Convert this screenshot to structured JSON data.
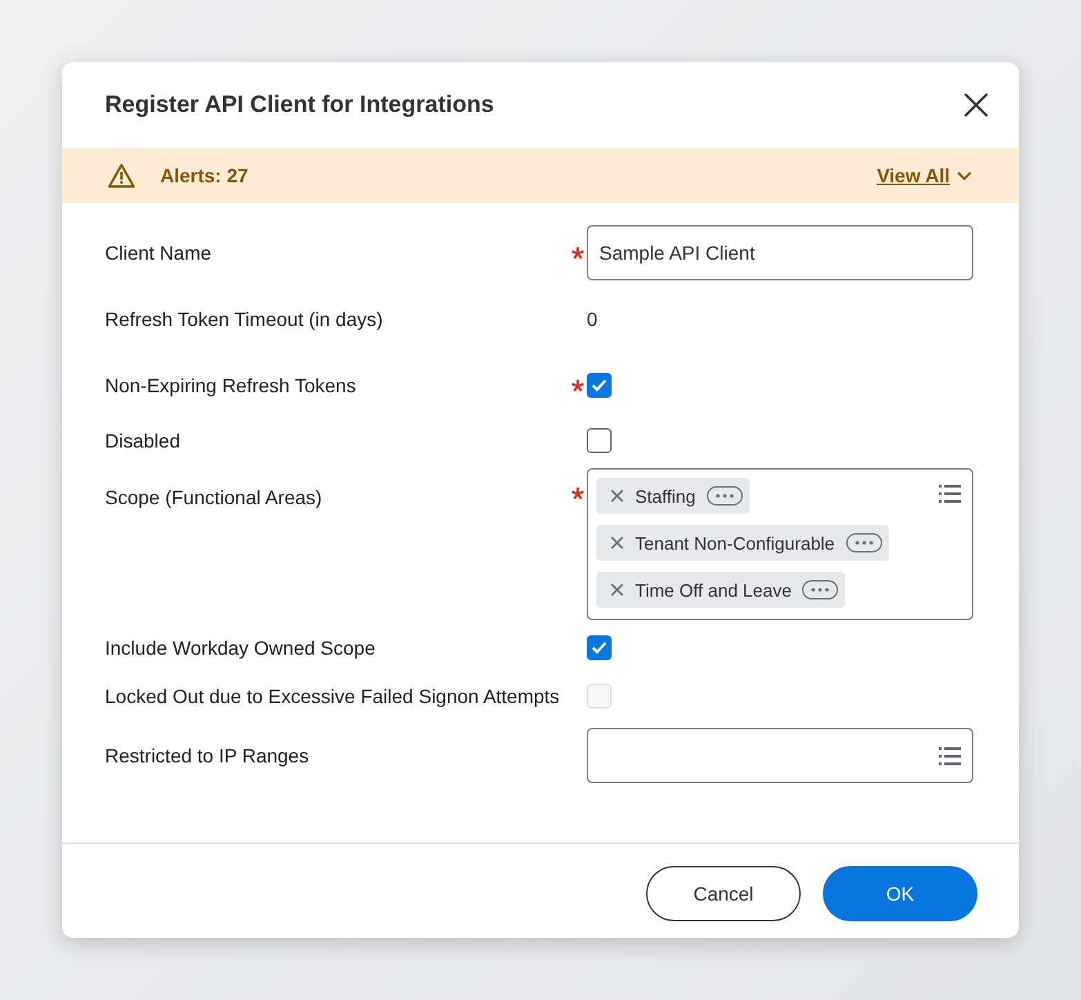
{
  "dialog": {
    "title": "Register API Client for Integrations"
  },
  "alert_bar": {
    "label": "Alerts: 27",
    "link": "View All"
  },
  "fields": [
    {
      "kind": "text",
      "label": "Client Name",
      "required": true,
      "value": "Sample API Client"
    },
    {
      "kind": "readonly",
      "label": "Refresh Token Timeout (in days)",
      "required": false,
      "value": "0"
    },
    {
      "kind": "checkbox",
      "label": "Non-Expiring Refresh Tokens",
      "required": true,
      "checked": true,
      "disabled": false
    },
    {
      "kind": "checkbox",
      "label": "Disabled",
      "required": false,
      "checked": false,
      "disabled": false
    },
    {
      "kind": "tags",
      "label": "Scope (Functional Areas)",
      "required": true,
      "tags": [
        "Staffing",
        "Tenant Non-Configurable",
        "Time Off and Leave"
      ]
    },
    {
      "kind": "checkbox",
      "label": "Include Workday Owned Scope",
      "required": false,
      "checked": true,
      "disabled": false
    },
    {
      "kind": "checkbox",
      "label": "Locked Out due to Excessive Failed Signon Attempts",
      "required": false,
      "checked": false,
      "disabled": true
    },
    {
      "kind": "prompt",
      "label": "Restricted to IP Ranges",
      "required": false
    }
  ],
  "buttons": [
    {
      "label": "Cancel",
      "kind": "secondary"
    },
    {
      "label": "OK",
      "kind": "primary"
    }
  ]
}
